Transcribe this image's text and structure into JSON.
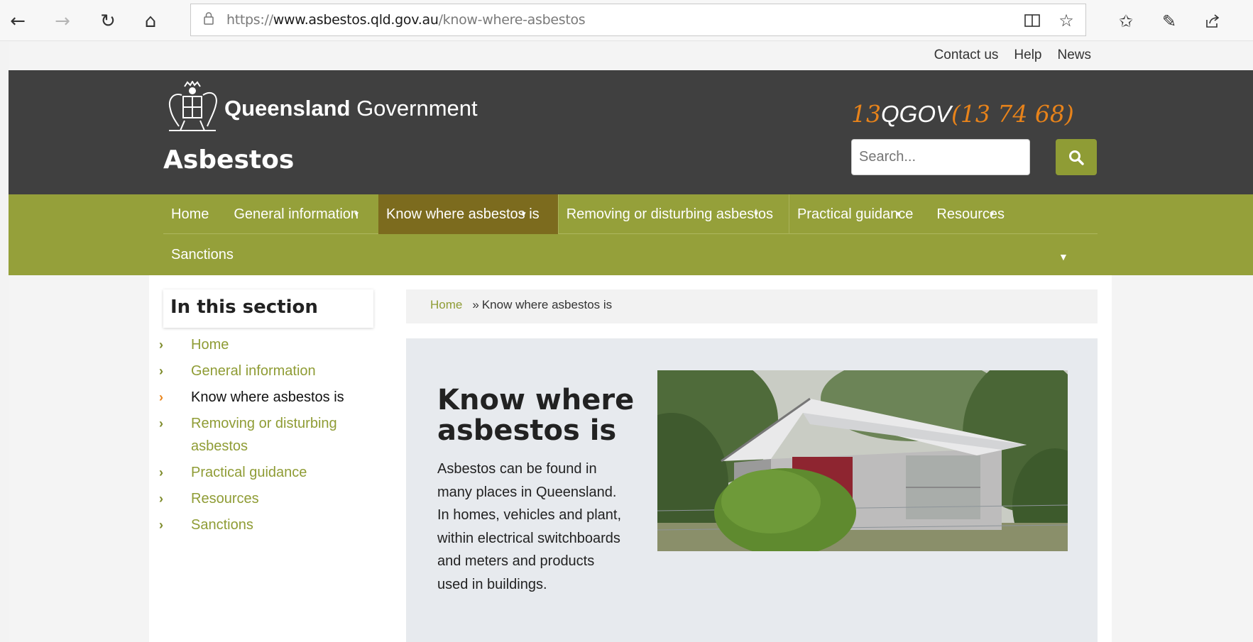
{
  "browser": {
    "url_scheme": "https://",
    "url_host": "www.asbestos.qld.gov.au",
    "url_path": "/know-where-asbestos"
  },
  "utility": {
    "links": [
      "Contact us",
      "Help",
      "News"
    ]
  },
  "header": {
    "brand_bold": "Queensland",
    "brand_light": "Government",
    "site_title": "Asbestos",
    "phone_num_1": "13",
    "phone_brand": "QGOV",
    "phone_num_2": "(13 74 68)",
    "search_placeholder": "Search..."
  },
  "nav": {
    "items": [
      "Home",
      "General information",
      "Know where asbestos is",
      "Removing or disturbing asbestos",
      "Practical guidance",
      "Resources",
      "Sanctions"
    ],
    "active": "Know where asbestos is"
  },
  "sidebar": {
    "title": "In this section",
    "items": [
      "Home",
      "General information",
      "Know where asbestos is",
      "Removing or disturbing asbestos",
      "Practical guidance",
      "Resources",
      "Sanctions"
    ]
  },
  "breadcrumb": {
    "home": "Home",
    "separator": "»",
    "current": "Know where asbestos is"
  },
  "hero": {
    "title": "Know where asbestos is",
    "body": "Asbestos can be found in many places in Queensland. In homes, vehicles and plant, within electrical switchboards and meters and products used in buildings."
  },
  "colors": {
    "header_bg": "#404040",
    "nav_green": "#95a03a",
    "active_nav": "#7c6b1e",
    "phone_orange": "#e8831a",
    "link_green": "#8f9c35"
  }
}
